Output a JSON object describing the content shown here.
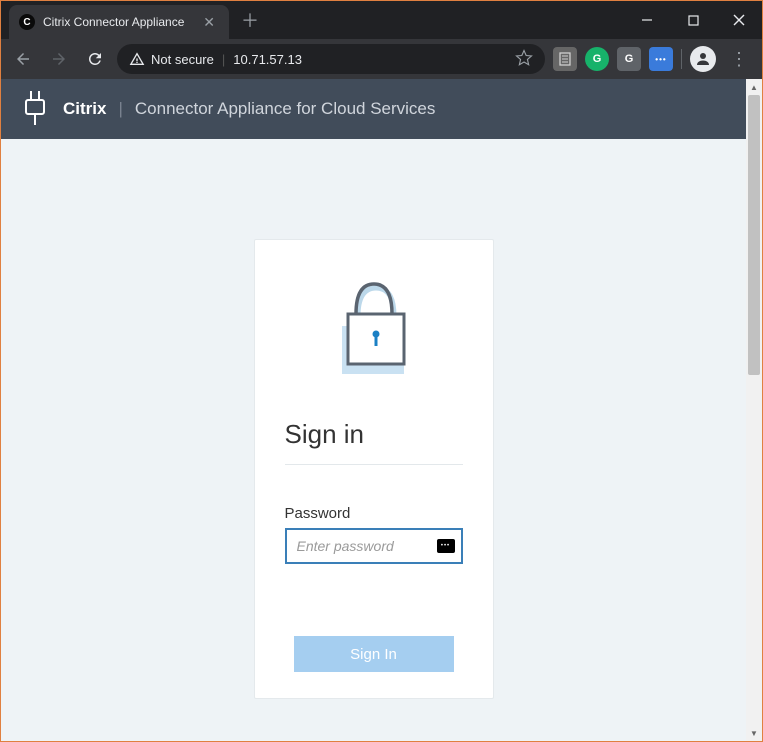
{
  "browser": {
    "tab": {
      "title": "Citrix Connector Appliance",
      "favicon_letter": "C"
    },
    "urlbar": {
      "insecure_label": "Not secure",
      "url": "10.71.57.13"
    }
  },
  "banner": {
    "brand": "Citrix",
    "subtitle": "Connector Appliance for Cloud Services"
  },
  "signin": {
    "title": "Sign in",
    "password_label": "Password",
    "password_placeholder": "Enter password",
    "button_label": "Sign In"
  }
}
